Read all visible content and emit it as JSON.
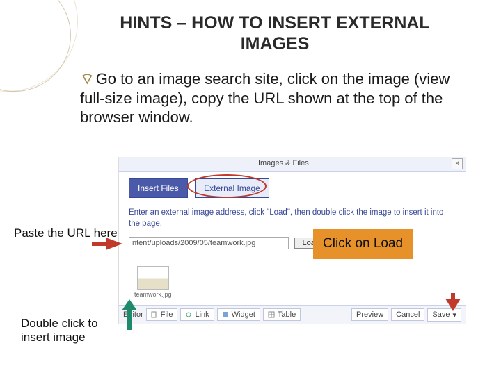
{
  "title": "HINTS – HOW TO INSERT EXTERNAL IMAGES",
  "bullet": "Go to an image search site,  click on the image (view full-size image), copy the URL shown at the top of the browser window.",
  "callouts": {
    "paste": "Paste the URL here",
    "load": "Click on Load",
    "double": "Double click to insert image"
  },
  "shot": {
    "header": "Images & Files",
    "tab_insert": "Insert Files",
    "tab_external": "External Image",
    "desc": "Enter an external image address, click \"Load\", then double click the image to insert it into the page.",
    "url_value": "ntent/uploads/2009/05/teamwork.jpg",
    "load_btn": "Load",
    "thumb_caption": "teamwork.jpg",
    "toolbar": {
      "editor": "Editor",
      "file": "File",
      "link": "Link",
      "widget": "Widget",
      "table": "Table",
      "preview": "Preview",
      "cancel": "Cancel",
      "save": "Save"
    }
  }
}
